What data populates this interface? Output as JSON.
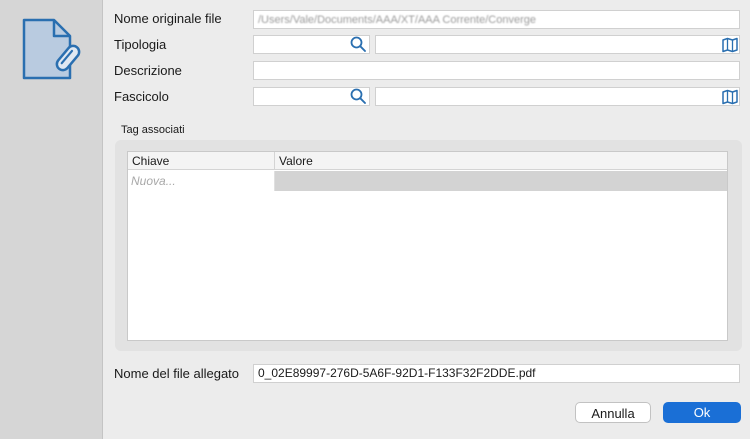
{
  "form": {
    "original_name_label": "Nome originale file",
    "original_name_value": "/Users/Vale/Documents/AAA/XT/AAA Corrente/Converge",
    "type_label": "Tipologia",
    "description_label": "Descrizione",
    "dossier_label": "Fascicolo"
  },
  "tags": {
    "group_label": "Tag associati",
    "columns": [
      "Chiave",
      "Valore"
    ],
    "new_row_placeholder": "Nuova..."
  },
  "attachment": {
    "label": "Nome del file allegato",
    "value": "0_02E89997-276D-5A6F-92D1-F133F32F2DDE.pdf"
  },
  "buttons": {
    "cancel": "Annulla",
    "ok": "Ok"
  },
  "colors": {
    "accent": "#1a6fd6",
    "icon": "#2a6fb0"
  }
}
